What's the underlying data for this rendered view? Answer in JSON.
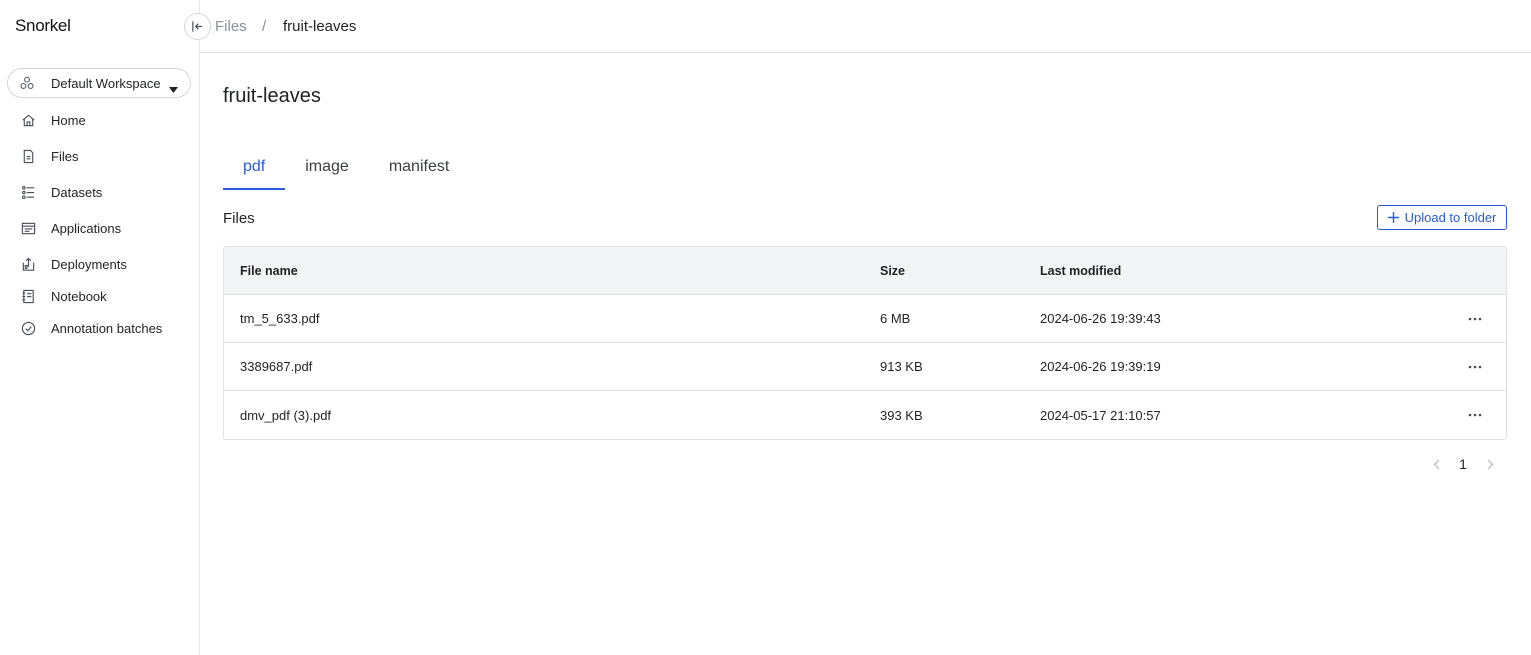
{
  "app": {
    "logo": "Snorkel"
  },
  "sidebar": {
    "workspace": "Default Workspace",
    "items": [
      {
        "label": "Home",
        "icon": "home-icon"
      },
      {
        "label": "Files",
        "icon": "file-icon"
      },
      {
        "label": "Datasets",
        "icon": "datasets-icon"
      },
      {
        "label": "Applications",
        "icon": "applications-icon"
      },
      {
        "label": "Deployments",
        "icon": "deployments-icon"
      },
      {
        "label": "Notebook",
        "icon": "notebook-icon"
      },
      {
        "label": "Annotation batches",
        "icon": "check-circle-icon"
      }
    ]
  },
  "breadcrumb": {
    "root": "Files",
    "separator": "/",
    "current": "fruit-leaves"
  },
  "page": {
    "title": "fruit-leaves",
    "tabs": [
      {
        "label": "pdf",
        "active": true
      },
      {
        "label": "image",
        "active": false
      },
      {
        "label": "manifest",
        "active": false
      }
    ],
    "section_label": "Files",
    "upload_label": "Upload to folder"
  },
  "table": {
    "headers": {
      "name": "File name",
      "size": "Size",
      "modified": "Last modified"
    },
    "rows": [
      {
        "name": "tm_5_633.pdf",
        "size": "6 MB",
        "modified": "2024-06-26 19:39:43"
      },
      {
        "name": "3389687.pdf",
        "size": "913 KB",
        "modified": "2024-06-26 19:39:19"
      },
      {
        "name": "dmv_pdf (3).pdf",
        "size": "393 KB",
        "modified": "2024-05-17 21:10:57"
      }
    ]
  },
  "pagination": {
    "current_page": "1"
  },
  "colors": {
    "accent": "#2a5bd7",
    "border": "#dfe1e5",
    "header_bg": "#f3f4f6"
  }
}
